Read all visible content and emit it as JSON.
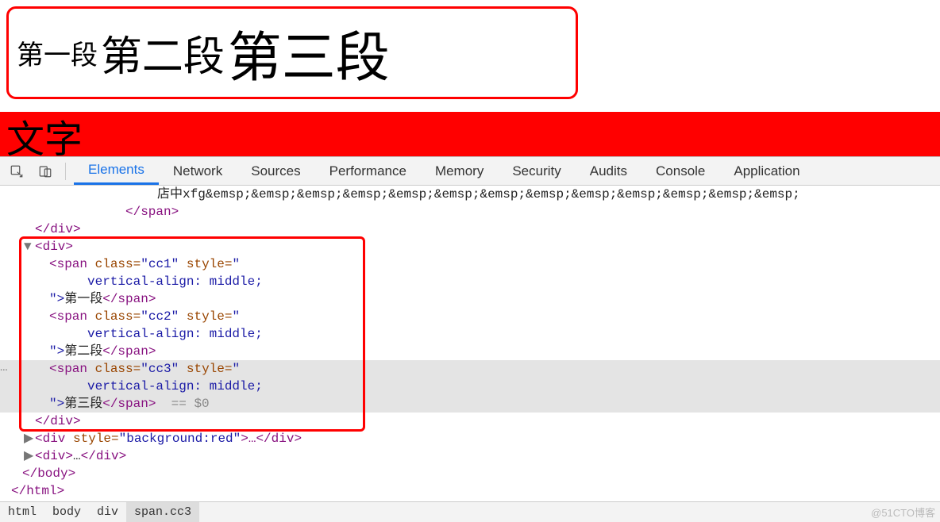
{
  "preview": {
    "seg1": "第一段",
    "seg2": "第二段",
    "seg3": "第三段",
    "red_text": "文字"
  },
  "devtools": {
    "tabs": [
      "Elements",
      "Network",
      "Sources",
      "Performance",
      "Memory",
      "Security",
      "Audits",
      "Console",
      "Application"
    ],
    "active_tab": "Elements",
    "overflow_text": "店中xfg&emsp;&emsp;&emsp;&emsp;&emsp;&emsp;&emsp;&emsp;&emsp;&emsp;&emsp;&emsp;&emsp;",
    "breadcrumb": [
      "html",
      "body",
      "div",
      "span.cc3"
    ],
    "selection_suffix": "== $0"
  },
  "dom": {
    "close_span": "</span>",
    "close_div": "</div>",
    "open_div": "<div>",
    "span1": {
      "open": "<span",
      "class_attr": "class=",
      "class_val": "\"cc1\"",
      "style_attr": "style=",
      "style_open": "\"",
      "style_body": "vertical-align: middle;",
      "close_open": "\">",
      "text": "第一段",
      "close": "</span>"
    },
    "span2": {
      "open": "<span",
      "class_attr": "class=",
      "class_val": "\"cc2\"",
      "style_attr": "style=",
      "style_open": "\"",
      "style_body": "vertical-align: middle;",
      "close_open": "\">",
      "text": "第二段",
      "close": "</span>"
    },
    "span3": {
      "open": "<span",
      "class_attr": "class=",
      "class_val": "\"cc3\"",
      "style_attr": "style=",
      "style_open": "\"",
      "style_body": "vertical-align: middle;",
      "close_open": "\">",
      "text": "第三段",
      "close": "</span>"
    },
    "bg_div": {
      "open": "<div",
      "style_attr": "style=",
      "style_val": "\"background:red\"",
      "mid": ">…",
      "close": "</div>"
    },
    "coll_div": {
      "open": "<div>",
      "mid": "…",
      "close": "</div>"
    },
    "close_body": "</body>",
    "close_html": "</html>"
  },
  "gutter_ellipsis": "…",
  "watermark": "@51CTO博客"
}
